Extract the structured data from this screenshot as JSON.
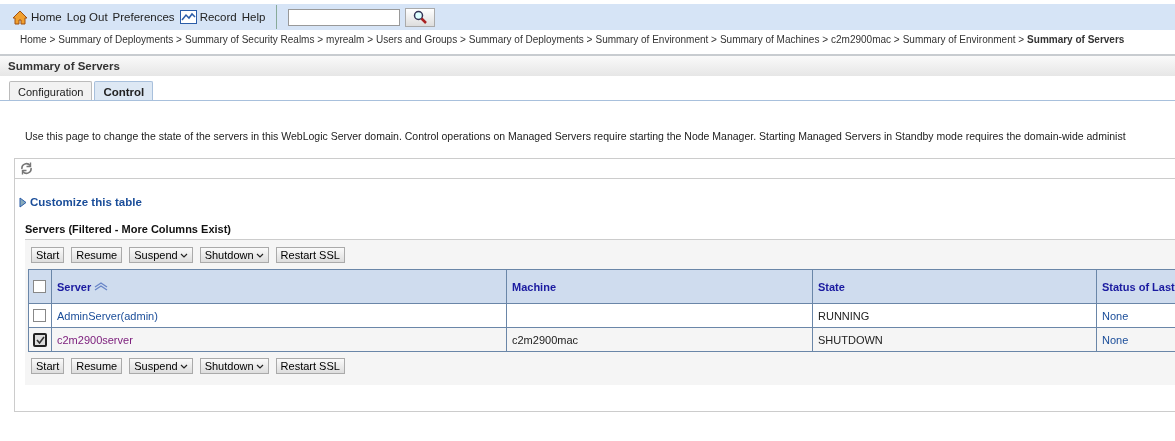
{
  "toolbar": {
    "links": [
      {
        "label": "Home",
        "kind": "home"
      },
      {
        "label": "Log Out",
        "kind": "text"
      },
      {
        "label": "Preferences",
        "kind": "text"
      },
      {
        "label": "Record",
        "kind": "chart"
      },
      {
        "label": "Help",
        "kind": "text"
      }
    ]
  },
  "breadcrumb": {
    "links": [
      "Home >",
      "Summary of Deployments >",
      "Summary of Security Realms >",
      "myrealm >",
      "Users and Groups >",
      "Summary of Deployments >",
      "Summary of Environment >",
      "Summary of Machines >",
      "c2m2900mac >",
      "Summary of Environment >"
    ],
    "current": "Summary of Servers"
  },
  "page_title": "Summary of Servers",
  "tabs": [
    {
      "label": "Configuration",
      "selected": false
    },
    {
      "label": "Control",
      "selected": true
    }
  ],
  "description": "Use this page to change the state of the servers in this WebLogic Server domain. Control operations on Managed Servers require starting the Node Manager. Starting Managed Servers in Standby mode requires the domain-wide administ",
  "customize_link": "Customize this table",
  "table": {
    "title": "Servers (Filtered - More Columns Exist)",
    "top_buttons": [
      {
        "label": "Start",
        "dropdown": false
      },
      {
        "label": "Resume",
        "dropdown": false
      },
      {
        "label": "Suspend",
        "dropdown": true
      },
      {
        "label": "Shutdown",
        "dropdown": true
      },
      {
        "label": "Restart SSL",
        "dropdown": false
      }
    ],
    "bottom_buttons": [
      {
        "label": "Start",
        "dropdown": false
      },
      {
        "label": "Resume",
        "dropdown": false
      },
      {
        "label": "Suspend",
        "dropdown": true
      },
      {
        "label": "Shutdown",
        "dropdown": true
      },
      {
        "label": "Restart SSL",
        "dropdown": false
      }
    ],
    "select_all_checked": false,
    "columns": [
      {
        "label": "Server",
        "sorted": true
      },
      {
        "label": "Machine",
        "sorted": false
      },
      {
        "label": "State",
        "sorted": false
      },
      {
        "label": "Status of Last",
        "sorted": false
      }
    ],
    "rows": [
      {
        "checked": false,
        "visited": false,
        "cells": [
          "AdminServer(admin)",
          "",
          "RUNNING",
          "None"
        ]
      },
      {
        "checked": true,
        "visited": true,
        "cells": [
          "c2m2900server",
          "c2m2900mac",
          "SHUTDOWN",
          "None"
        ]
      }
    ]
  }
}
